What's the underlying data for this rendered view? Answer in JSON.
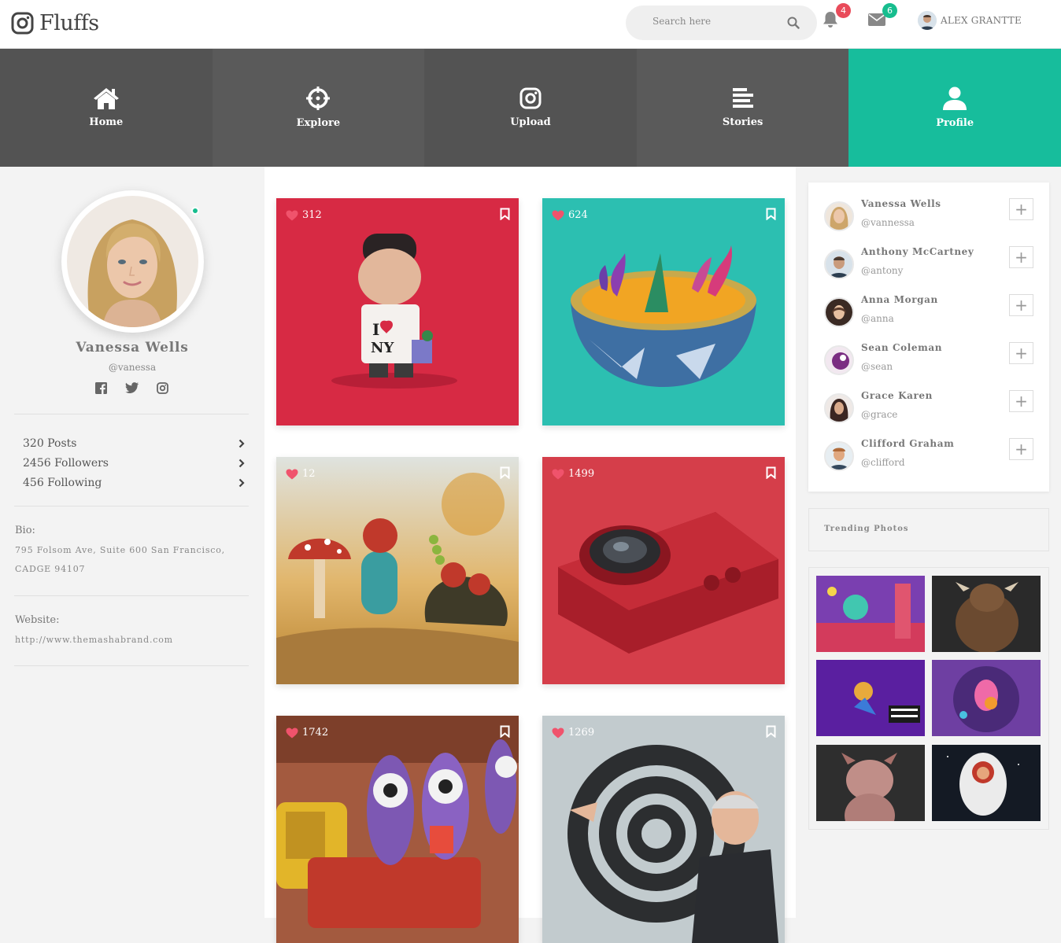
{
  "app": {
    "name": "Fluffs"
  },
  "header": {
    "search_placeholder": "Search here",
    "notifications_count": "4",
    "messages_count": "6",
    "user_name": "ALEX GRANTTE"
  },
  "nav": {
    "items": [
      {
        "label": "Home",
        "icon": "home-icon"
      },
      {
        "label": "Explore",
        "icon": "crosshair-icon"
      },
      {
        "label": "Upload",
        "icon": "instagram-icon"
      },
      {
        "label": "Stories",
        "icon": "stories-icon"
      },
      {
        "label": "Profile",
        "icon": "user-icon",
        "active": true
      }
    ]
  },
  "profile": {
    "name": "Vanessa Wells",
    "handle": "@vanessa",
    "stats": [
      {
        "label": "320 Posts"
      },
      {
        "label": "2456 Followers"
      },
      {
        "label": "456 Following"
      }
    ],
    "bio_label": "Bio:",
    "bio": "795 Folsom Ave, Suite 600 San Francisco, CADGE 94107",
    "website_label": "Website:",
    "website": "http://www.themashabrand.com"
  },
  "posts": [
    {
      "likes": "312",
      "bg": "#d72a44",
      "icon": "heart-icon"
    },
    {
      "likes": "624",
      "bg": "#2cbfb1",
      "icon": "heart-icon"
    },
    {
      "likes": "12",
      "bg": "#d9b36b",
      "icon": "heart-icon"
    },
    {
      "likes": "1499",
      "bg": "#d53e4a",
      "icon": "heart-icon"
    },
    {
      "likes": "1742",
      "bg": "#a35a3f",
      "icon": "heart-icon"
    },
    {
      "likes": "1269",
      "bg": "#bfc8cb",
      "icon": "heart-icon"
    }
  ],
  "suggestions": [
    {
      "name": "Vanessa Wells",
      "handle": "@vannessa"
    },
    {
      "name": "Anthony McCartney",
      "handle": "@antony"
    },
    {
      "name": "Anna Morgan",
      "handle": "@anna"
    },
    {
      "name": "Sean Coleman",
      "handle": "@sean"
    },
    {
      "name": "Grace Karen",
      "handle": "@grace"
    },
    {
      "name": "Clifford Graham",
      "handle": "@clifford"
    }
  ],
  "trending": {
    "title": "Trending Photos"
  },
  "colors": {
    "accent": "#17bd9c",
    "nav_bg": "#535353",
    "badge_red": "#e94b5a",
    "badge_green": "#17bd8e"
  }
}
